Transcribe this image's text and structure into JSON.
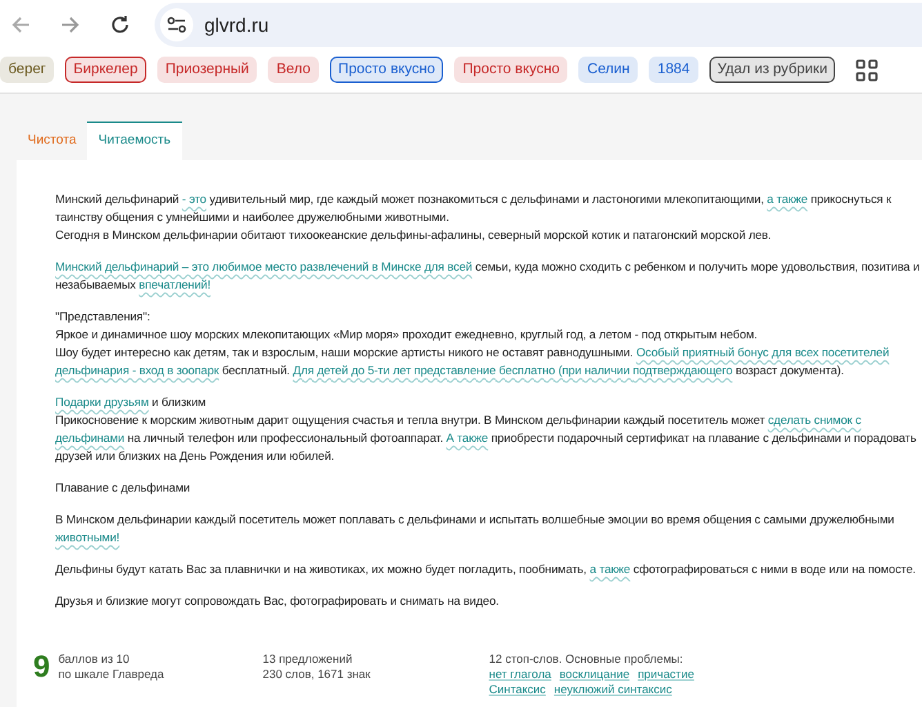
{
  "browser": {
    "back_disabled": true,
    "url": "glvrd.ru"
  },
  "bookmarks": [
    {
      "label": "берег",
      "color": "#6b5a20",
      "outlined": false
    },
    {
      "label": "Биркелер",
      "color": "#c62828",
      "outlined": true
    },
    {
      "label": "Приозерный",
      "color": "#c62828",
      "outlined": false
    },
    {
      "label": "Вело",
      "color": "#c62828",
      "outlined": false
    },
    {
      "label": "Просто вкусно",
      "color": "#1a5fd0",
      "outlined": true
    },
    {
      "label": "Просто вкусно",
      "color": "#c62828",
      "outlined": false
    },
    {
      "label": "Селин",
      "color": "#1a5fd0",
      "outlined": false
    },
    {
      "label": "1884",
      "color": "#1a5fd0",
      "outlined": false
    },
    {
      "label": "Удал из рубрики",
      "color": "#444444",
      "outlined": true
    }
  ],
  "tabs": [
    {
      "label": "Чистота",
      "selected": false,
      "color": "#e06a1b"
    },
    {
      "label": "Читаемость",
      "selected": true,
      "color": "#1a8a8a"
    }
  ],
  "paragraphs": [
    {
      "lines": [
        [
          {
            "text": "Минский дельфинарий ",
            "marked": false
          },
          {
            "text": "- это",
            "marked": true
          },
          {
            "text": " удивительный мир, где каждый может познакомиться с дельфинами и ластоногими млекопитающими, ",
            "marked": false
          },
          {
            "text": "а также",
            "marked": true
          },
          {
            "text": " прикоснуться к таинству общения с умнейшими и наиболее дружелюбными животными.",
            "marked": false
          }
        ],
        [
          {
            "text": "Сегодня в Минском дельфинарии обитают тихоокеанские дельфины-афалины, северный морской котик и патагонский морской лев.",
            "marked": false
          }
        ]
      ]
    },
    {
      "lines": [
        [
          {
            "text": "Минский дельфинарий – это любимое место развлечений в Минске для всей",
            "marked": true
          },
          {
            "text": " семьи, куда можно сходить с ребенком и получить море удовольствия, позитива и незабываемых ",
            "marked": false
          },
          {
            "text": "впечатлений!",
            "marked": true
          }
        ]
      ]
    },
    {
      "lines": [
        [
          {
            "text": "\"Представления\":",
            "marked": false
          }
        ],
        [
          {
            "text": "Яркое и динамичное шоу морских млекопитающих   «Мир моря» проходит ежедневно, круглый год, а летом - под открытым небом.",
            "marked": false
          }
        ],
        [
          {
            "text": "Шоу будет интересно как детям, так и взрослым, наши морские артисты никого не оставят равнодушными. ",
            "marked": false
          },
          {
            "text": "Особый приятный бонус для всех  посетителей дельфинария - вход в зоопарк",
            "marked": true
          },
          {
            "text": " бесплатный. ",
            "marked": false
          },
          {
            "text": "Для детей до 5-ти лет представление бесплатно (при наличии ",
            "marked": true
          },
          {
            "text": "подтверждающего",
            "marked": true
          },
          {
            "text": " возраст документа).",
            "marked": false
          }
        ]
      ]
    },
    {
      "lines": [
        [
          {
            "text": "Подарки друзьям",
            "marked": true
          },
          {
            "text": " и близким",
            "marked": false
          }
        ],
        [
          {
            "text": "Прикосновение к морским животным дарит ощущения счастья и тепла внутри. В Минском дельфинарии каждый посетитель может ",
            "marked": false
          },
          {
            "text": "сделать снимок с дельфинами",
            "marked": true
          },
          {
            "text": " на личный телефон или профессиональный фотоаппарат. ",
            "marked": false
          },
          {
            "text": "А также",
            "marked": true
          },
          {
            "text": " приобрести  подарочный сертификат на плавание  с дельфинами и порадовать друзей или близких на День Рождения или юбилей.",
            "marked": false
          }
        ]
      ]
    },
    {
      "lines": [
        [
          {
            "text": "Плавание с дельфинами",
            "marked": false
          }
        ]
      ]
    },
    {
      "lines": [
        [
          {
            "text": "В Минском дельфинарии каждый посетитель может поплавать с дельфинами и испытать волшебные эмоции во время общения с самыми дружелюбными ",
            "marked": false
          },
          {
            "text": "животными!",
            "marked": true
          }
        ]
      ]
    },
    {
      "lines": [
        [
          {
            "text": "Дельфины будут катать Вас за плавнички и на животиках, их можно будет погладить, пообнимать, ",
            "marked": false
          },
          {
            "text": "а также",
            "marked": true
          },
          {
            "text": " сфотографироваться с ними в воде или на помосте.",
            "marked": false
          }
        ]
      ]
    },
    {
      "lines": [
        [
          {
            "text": "Друзья и близкие могут сопровождать Вас, фотографировать и снимать на видео.",
            "marked": false
          }
        ]
      ]
    }
  ],
  "stats": {
    "score": "9",
    "score_label": "баллов из 10",
    "score_scale": "по шкале Главреда",
    "sentences": "13 предложений",
    "counts": "230 слов, 1671 знак",
    "stopwords": "12 стоп-слов. Основные проблемы:",
    "problems": [
      "нет глагола",
      "восклицание",
      "причастие",
      "Синтаксис",
      "неуклюжий синтаксис"
    ]
  }
}
